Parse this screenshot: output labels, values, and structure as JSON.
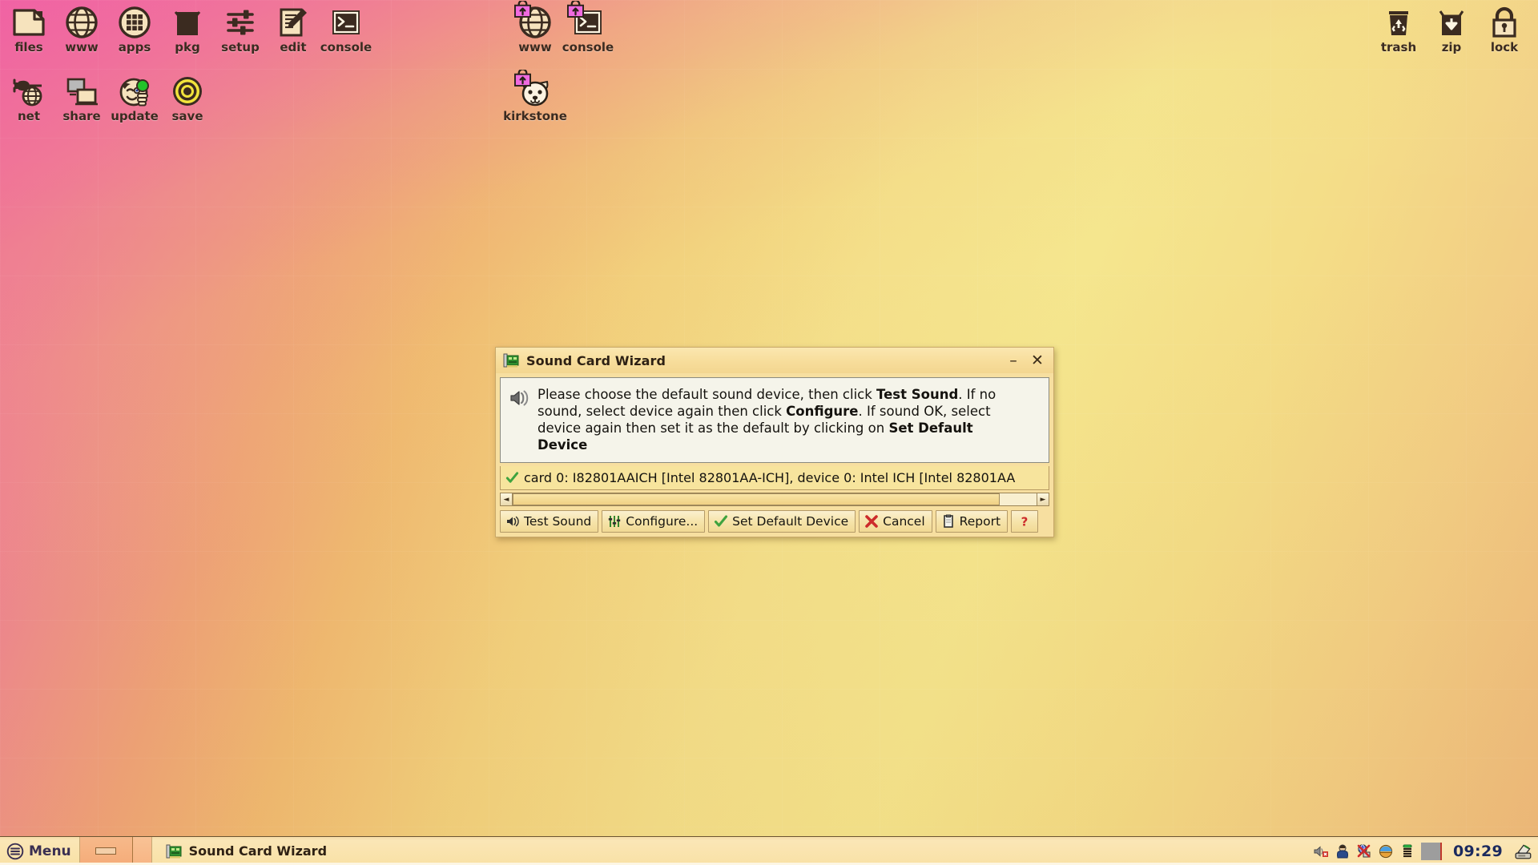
{
  "desktop": {
    "icons_left_row1": [
      {
        "label": "files",
        "icon": "folder-icon"
      },
      {
        "label": "www",
        "icon": "globe-icon"
      },
      {
        "label": "apps",
        "icon": "apps-grid-icon"
      },
      {
        "label": "pkg",
        "icon": "package-box-icon"
      },
      {
        "label": "setup",
        "icon": "sliders-icon"
      },
      {
        "label": "edit",
        "icon": "edit-pencil-icon"
      },
      {
        "label": "console",
        "icon": "terminal-icon"
      }
    ],
    "icons_left_row2": [
      {
        "label": "net",
        "icon": "network-plug-icon"
      },
      {
        "label": "share",
        "icon": "share-screens-icon"
      },
      {
        "label": "update",
        "icon": "update-puppy-icon"
      },
      {
        "label": "save",
        "icon": "save-target-icon"
      }
    ],
    "icons_mid_row1": [
      {
        "label": "www",
        "icon": "globe-icon",
        "badge": "lock-badge"
      },
      {
        "label": "console",
        "icon": "terminal-icon",
        "badge": "lock-badge"
      }
    ],
    "icons_mid_row2": [
      {
        "label": "kirkstone",
        "icon": "puppy-face-icon",
        "badge": "lock-badge"
      }
    ],
    "icons_right": [
      {
        "label": "trash",
        "icon": "trash-recycle-icon"
      },
      {
        "label": "zip",
        "icon": "zip-download-icon"
      },
      {
        "label": "lock",
        "icon": "padlock-icon"
      }
    ]
  },
  "dialog": {
    "title": "Sound Card Wizard",
    "title_icon": "sound-card-icon",
    "minimize_label": "–",
    "close_label": "✕",
    "message_icon": "speaker-icon",
    "message": {
      "part1": "Please choose the default sound device, then click ",
      "bold1": "Test Sound",
      "part2": ". If no sound, select device again then click ",
      "bold2": "Configure",
      "part3": ". If sound OK, select device again then set it as the default by clicking on ",
      "bold3": "Set Default Device"
    },
    "device_row": {
      "check_icon": "green-check-icon",
      "text": "card 0: I82801AAICH [Intel 82801AA-ICH], device 0: Intel ICH [Intel 82801AA"
    },
    "scrollbar": {
      "left_arrow": "◄",
      "right_arrow": "►",
      "thumb_width_pct": 93
    },
    "buttons": [
      {
        "label": "Test Sound",
        "icon": "speaker-wave-icon"
      },
      {
        "label": "Configure...",
        "icon": "mixer-faders-icon"
      },
      {
        "label": "Set Default Device",
        "icon": "green-check-icon"
      },
      {
        "label": "Cancel",
        "icon": "red-x-icon"
      },
      {
        "label": "Report",
        "icon": "clipboard-icon"
      },
      {
        "label": "?",
        "icon": "help-question-icon"
      }
    ]
  },
  "taskbar": {
    "menu_label": "Menu",
    "menu_icon": "menu-hamburger-icon",
    "show_desktop_icon": "show-desktop-icon",
    "tasks": [
      {
        "label": "Sound Card Wizard",
        "icon": "sound-card-icon"
      }
    ],
    "tray": [
      {
        "name": "volume-muted-icon"
      },
      {
        "name": "user-icon"
      },
      {
        "name": "network-disconnected-icon"
      },
      {
        "name": "globe-color-icon"
      },
      {
        "name": "battery-stack-icon"
      },
      {
        "name": "gray-block-icon"
      }
    ],
    "clock": "09:29",
    "trailing_icon": "printer-icon"
  },
  "colors": {
    "wallpaper_pink": "#ef5fa6",
    "wallpaper_yellow": "#f4e08b",
    "wallpaper_orange": "#eeba7c",
    "dialog_bg": "#f7dfa0",
    "msg_bg": "#f5f4ea",
    "list_bg": "#f7e49d",
    "accent_green": "#3fa33f",
    "accent_red": "#cc2b2b",
    "taskbar_bg": "#f9e2a8",
    "clock_color": "#1b2a5e"
  }
}
